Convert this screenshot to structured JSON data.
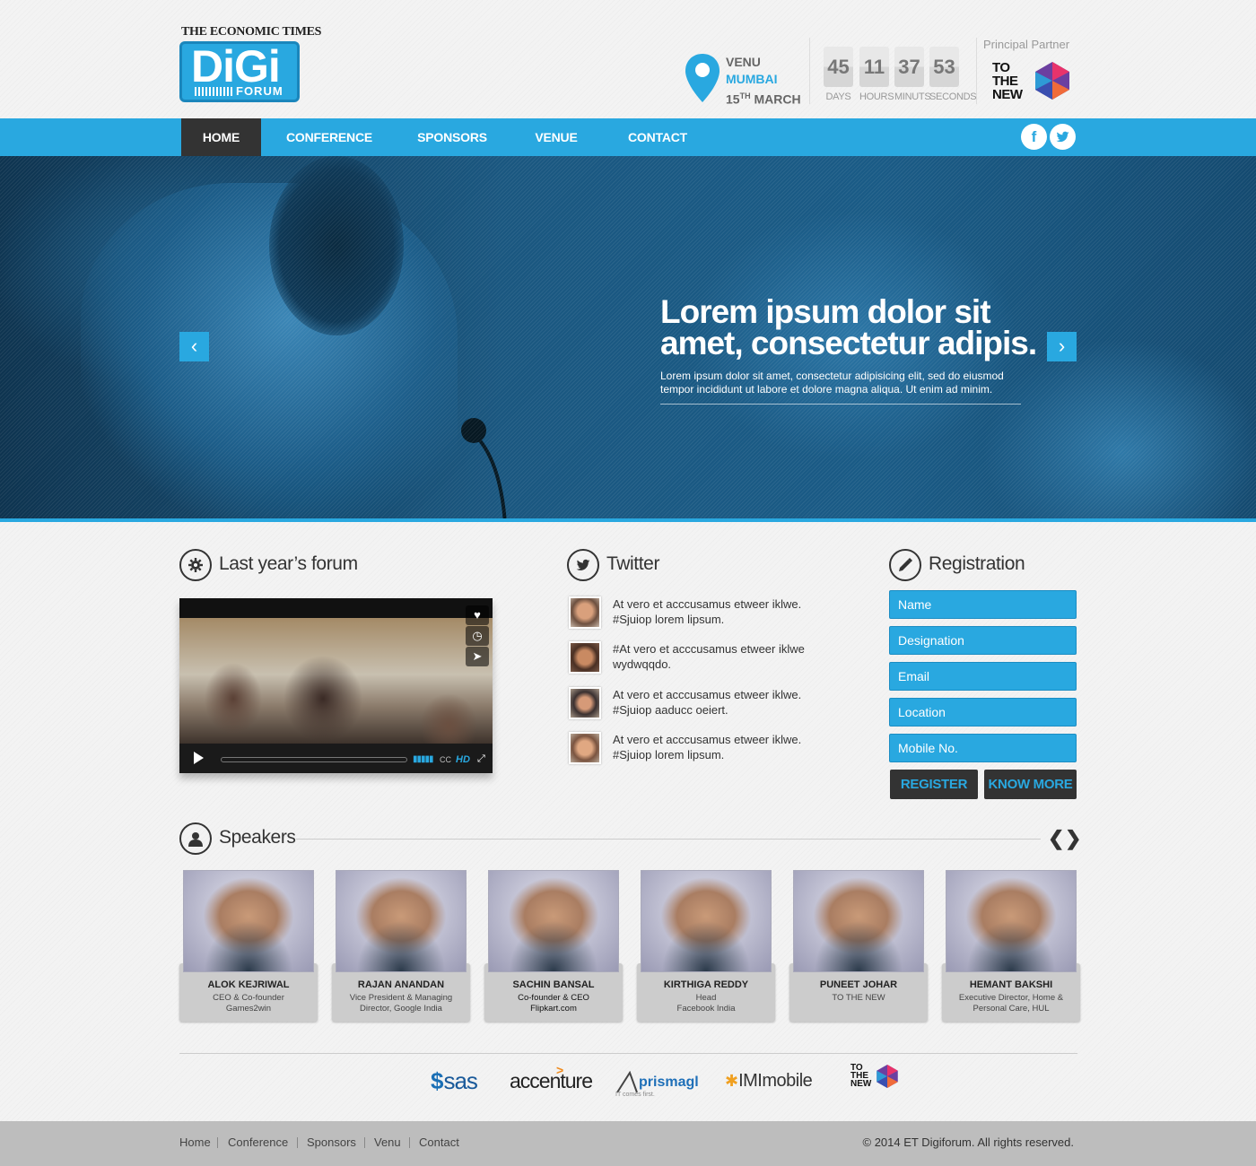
{
  "brand": {
    "publisher": "THE ECONOMIC TIMES",
    "logo_main": "DiGi",
    "logo_sub": "FORUM"
  },
  "venue": {
    "label": "VENU",
    "city": "MUMBAI",
    "date_day": "15",
    "date_suffix": "TH",
    "date_month": "MARCH",
    "icon": "map-pin-icon"
  },
  "countdown": [
    {
      "value": "45",
      "label": "DAYS"
    },
    {
      "value": "11",
      "label": "HOURS"
    },
    {
      "value": "37",
      "label": "MINUTS"
    },
    {
      "value": "53",
      "label": "SECONDS"
    }
  ],
  "partner": {
    "title": "Principal Partner",
    "logo_text": [
      "TO",
      "THE",
      "NEW"
    ]
  },
  "nav": {
    "items": [
      "HOME",
      "CONFERENCE",
      "SPONSORS",
      "VENUE",
      "CONTACT"
    ],
    "active": "HOME",
    "social": [
      {
        "name": "facebook-icon",
        "glyph": "f"
      },
      {
        "name": "twitter-icon",
        "glyph": "t"
      }
    ]
  },
  "hero": {
    "title": "Lorem ipsum dolor sit amet, consectetur adipis.",
    "subtitle": "Lorem ipsum dolor sit amet, consectetur adipisicing elit, sed do eiusmod tempor incididunt ut labore et dolore magna aliqua. Ut enim ad minim.",
    "prev": "‹",
    "next": "›"
  },
  "sections": {
    "forum": "Last year’s forum",
    "twitter": "Twitter",
    "registration": "Registration",
    "speakers": "Speakers"
  },
  "video": {
    "hd_label": "HD",
    "cc_label": "CC",
    "side_icons": [
      "heart-icon",
      "clock-icon",
      "send-icon"
    ]
  },
  "tweets": [
    {
      "text": "At vero et acccusamus etweer iklwe. #Sjuiop lorem lipsum."
    },
    {
      "text": "#At vero et acccusamus etweer iklwe wydwqqdo."
    },
    {
      "text": "At vero et acccusamus etweer iklwe. #Sjuiop aaducc oeiert."
    },
    {
      "text": "At vero et acccusamus etweer iklwe. #Sjuiop lorem lipsum."
    }
  ],
  "registration": {
    "fields": [
      "Name",
      "Designation",
      "Email",
      "Location",
      "Mobile No."
    ],
    "register_label": "REGISTER",
    "know_more_label": "KNOW MORE"
  },
  "speakers_nav": {
    "prev": "❮",
    "next": "❯"
  },
  "speakers": [
    {
      "name": "ALOK KEJRIWAL",
      "role": [
        "CEO & Co-founder",
        "Games2win"
      ]
    },
    {
      "name": "RAJAN ANANDAN",
      "role": [
        "Vice President & Managing",
        "Director, Google India"
      ]
    },
    {
      "name": "SACHIN BANSAL",
      "role": [
        "Co-founder & CEO",
        "Flipkart.com"
      ]
    },
    {
      "name": "KIRTHIGA REDDY",
      "role": [
        "Head",
        "Facebook India"
      ]
    },
    {
      "name": "PUNEET JOHAR",
      "role": [
        "TO THE NEW"
      ]
    },
    {
      "name": "HEMANT BAKSHI",
      "role": [
        "Executive Director, Home &",
        "Personal Care, HUL"
      ]
    }
  ],
  "sponsors": [
    {
      "name": "sas",
      "text": "sas"
    },
    {
      "name": "accenture",
      "text": "accenture"
    },
    {
      "name": "prismagl",
      "text": "prismagl",
      "tagline": "IT comes first."
    },
    {
      "name": "imimobile",
      "text": "IMImobile"
    },
    {
      "name": "tothenew",
      "text": [
        "TO",
        "THE",
        "NEW"
      ]
    }
  ],
  "footer": {
    "links": [
      "Home",
      "Conference",
      "Sponsors",
      "Venu",
      "Contact"
    ],
    "copyright": "© 2014 ET Digiforum. All rights reserved."
  },
  "colors": {
    "accent": "#29a8e0",
    "dark": "#333333",
    "footer": "#bdbdbd"
  }
}
